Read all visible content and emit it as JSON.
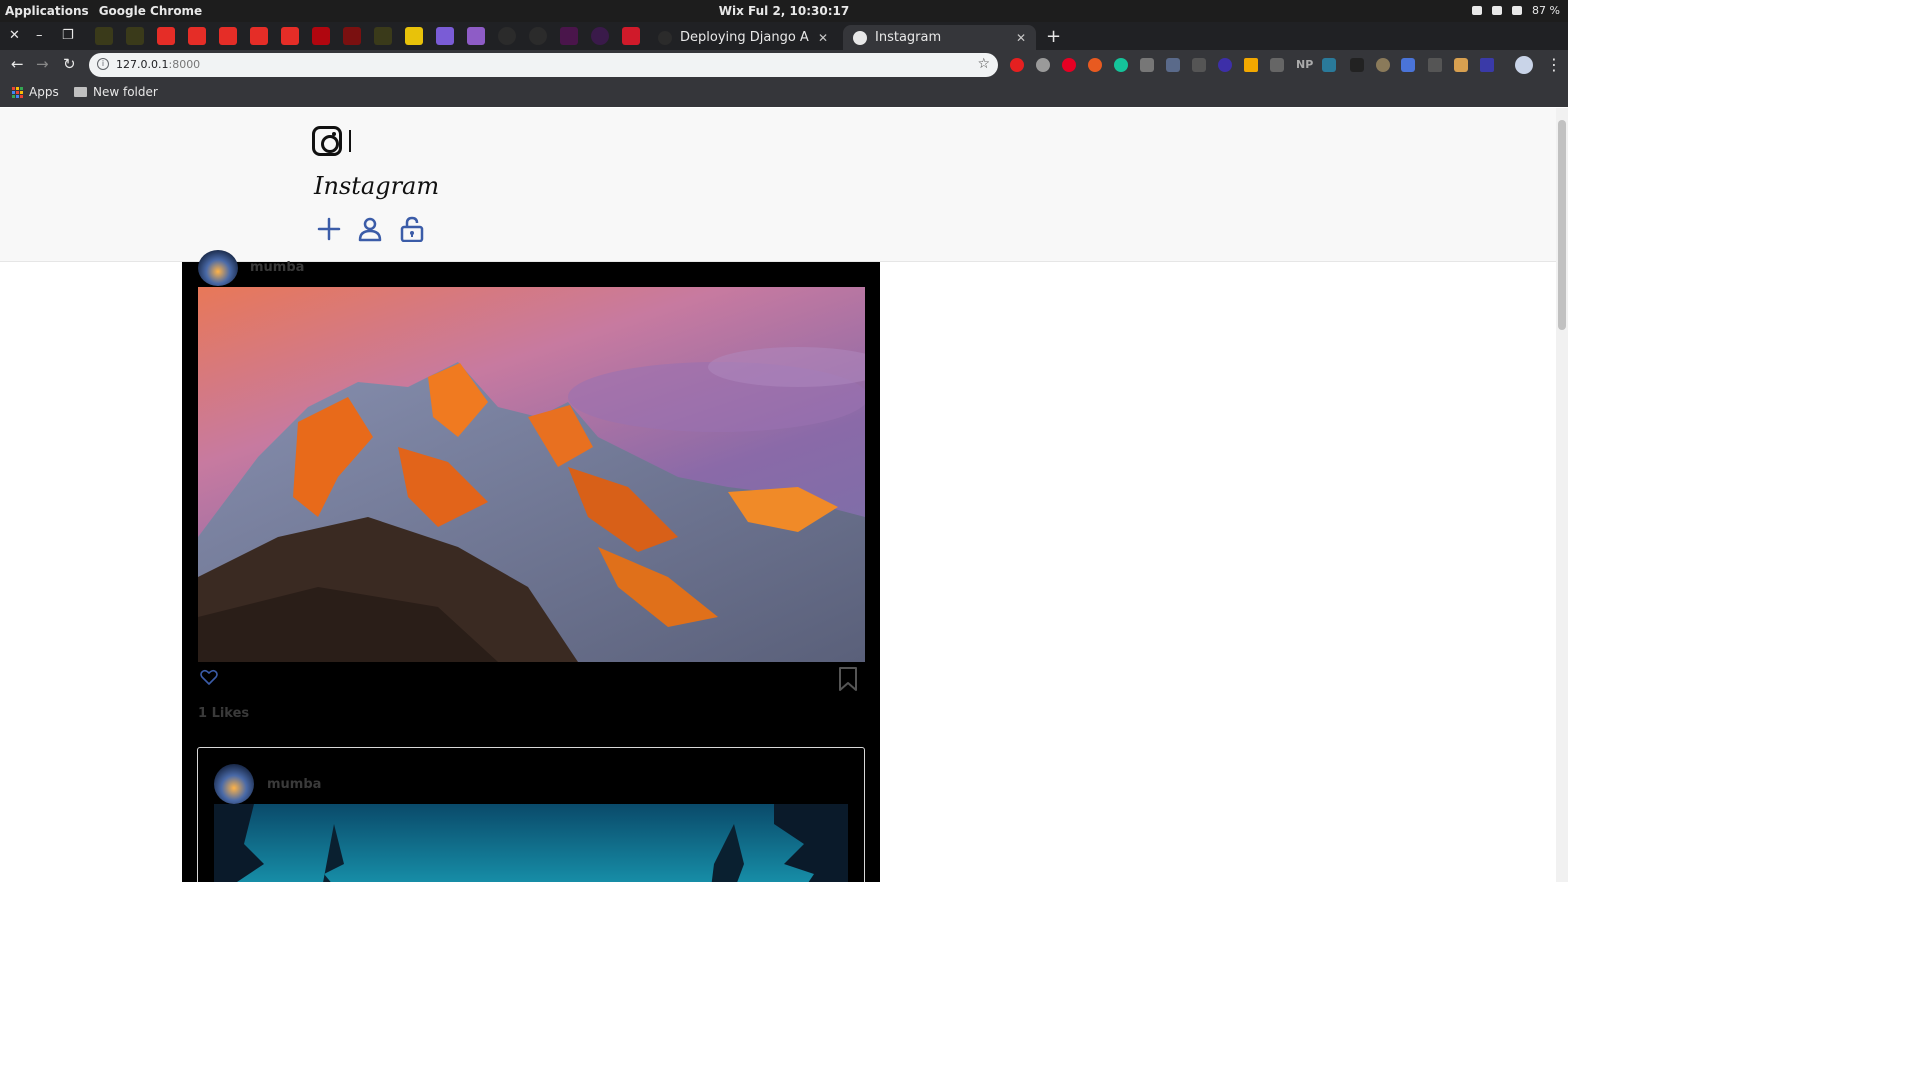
{
  "os_bar": {
    "applications": "Applications",
    "app_name": "Google Chrome",
    "clock": "Wix Ful  2, 10:30:17",
    "battery": "87 %"
  },
  "browser": {
    "tabs": [
      {
        "title": "Deploying Django Applica",
        "favicon": "github-icon"
      },
      {
        "title": "Instagram",
        "favicon": "globe-icon",
        "active": true
      }
    ],
    "pinned_tab_icons": [
      "tree-icon",
      "tree-icon",
      "youtube-icon",
      "youtube-icon",
      "youtube-icon",
      "youtube-icon",
      "youtube-icon",
      "netflix-icon",
      "media-icon",
      "tree-icon",
      "note-icon",
      "slash-icon",
      "h-icon",
      "github-icon",
      "github-icon",
      "slack-icon",
      "circle-icon",
      "ts-icon"
    ],
    "url_host": "127.0.0.1",
    "url_port": ":8000",
    "bookmarks": [
      {
        "label": "Apps",
        "icon": "apps-grid-icon"
      },
      {
        "label": "New folder",
        "icon": "folder-icon"
      }
    ],
    "extension_icons": [
      "adblock-icon",
      "abp-icon",
      "pinterest-icon",
      "color-icon",
      "grammarly-icon",
      "location-icon",
      "dots-icon",
      "download-icon",
      "circle-icon",
      "play-icon",
      "arrow-icon",
      "np-icon",
      "m-icon",
      "cube-icon",
      "face-icon",
      "translate-icon",
      "bookmark-icon",
      "box-icon",
      "flag-icon"
    ],
    "extension_text": {
      "np": "NP"
    }
  },
  "site": {
    "brand": "Instagram",
    "nav_icons": [
      "plus-icon",
      "user-icon",
      "unlock-icon"
    ]
  },
  "feed": {
    "posts": [
      {
        "username": "mumba",
        "likes": "1 Likes",
        "image": "mountain-sunset"
      },
      {
        "username": "mumba",
        "image": "night-forest"
      }
    ]
  },
  "colors": {
    "icon_blue": "#3b5ca8",
    "feed_bg": "#000000",
    "nav_bg": "#f8f8f8",
    "chrome_dark": "#202124",
    "chrome_toolbar": "#35363a"
  }
}
